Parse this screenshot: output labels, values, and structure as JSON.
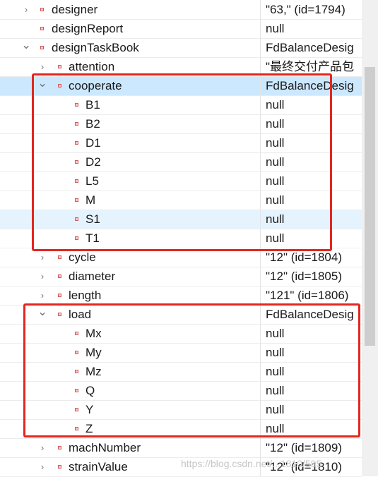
{
  "tree": {
    "rows": [
      {
        "id": "designer",
        "name": "designer",
        "value": "\"63,\" (id=1794)",
        "depth": 0,
        "arrow": "collapsed",
        "state": ""
      },
      {
        "id": "designReport",
        "name": "designReport",
        "value": "null",
        "depth": 0,
        "arrow": "none",
        "state": ""
      },
      {
        "id": "designTaskBook",
        "name": "designTaskBook",
        "value": "FdBalanceDesig",
        "depth": 0,
        "arrow": "expanded",
        "state": ""
      },
      {
        "id": "attention",
        "name": "attention",
        "value": "\"最终交付产品包",
        "depth": 1,
        "arrow": "collapsed",
        "state": ""
      },
      {
        "id": "cooperate",
        "name": "cooperate",
        "value": "FdBalanceDesig",
        "depth": 1,
        "arrow": "expanded",
        "state": "selected"
      },
      {
        "id": "B1",
        "name": "B1",
        "value": "null",
        "depth": 2,
        "arrow": "none",
        "state": ""
      },
      {
        "id": "B2",
        "name": "B2",
        "value": "null",
        "depth": 2,
        "arrow": "none",
        "state": ""
      },
      {
        "id": "D1",
        "name": "D1",
        "value": "null",
        "depth": 2,
        "arrow": "none",
        "state": ""
      },
      {
        "id": "D2",
        "name": "D2",
        "value": "null",
        "depth": 2,
        "arrow": "none",
        "state": ""
      },
      {
        "id": "L5",
        "name": "L5",
        "value": "null",
        "depth": 2,
        "arrow": "none",
        "state": ""
      },
      {
        "id": "M",
        "name": "M",
        "value": "null",
        "depth": 2,
        "arrow": "none",
        "state": ""
      },
      {
        "id": "S1",
        "name": "S1",
        "value": "null",
        "depth": 2,
        "arrow": "none",
        "state": "hover"
      },
      {
        "id": "T1",
        "name": "T1",
        "value": "null",
        "depth": 2,
        "arrow": "none",
        "state": ""
      },
      {
        "id": "cycle",
        "name": "cycle",
        "value": "\"12\" (id=1804)",
        "depth": 1,
        "arrow": "collapsed",
        "state": ""
      },
      {
        "id": "diameter",
        "name": "diameter",
        "value": "\"12\" (id=1805)",
        "depth": 1,
        "arrow": "collapsed",
        "state": ""
      },
      {
        "id": "length",
        "name": "length",
        "value": "\"121\" (id=1806)",
        "depth": 1,
        "arrow": "collapsed",
        "state": ""
      },
      {
        "id": "load",
        "name": "load",
        "value": "FdBalanceDesig",
        "depth": 1,
        "arrow": "expanded",
        "state": ""
      },
      {
        "id": "Mx",
        "name": "Mx",
        "value": "null",
        "depth": 2,
        "arrow": "none",
        "state": ""
      },
      {
        "id": "My",
        "name": "My",
        "value": "null",
        "depth": 2,
        "arrow": "none",
        "state": ""
      },
      {
        "id": "Mz",
        "name": "Mz",
        "value": "null",
        "depth": 2,
        "arrow": "none",
        "state": ""
      },
      {
        "id": "Q",
        "name": "Q",
        "value": "null",
        "depth": 2,
        "arrow": "none",
        "state": ""
      },
      {
        "id": "Y",
        "name": "Y",
        "value": "null",
        "depth": 2,
        "arrow": "none",
        "state": ""
      },
      {
        "id": "Z",
        "name": "Z",
        "value": "null",
        "depth": 2,
        "arrow": "none",
        "state": ""
      },
      {
        "id": "machNumber",
        "name": "machNumber",
        "value": "\"12\" (id=1809)",
        "depth": 1,
        "arrow": "collapsed",
        "state": ""
      },
      {
        "id": "strainValue",
        "name": "strainValue",
        "value": "\"12\" (id=1810)",
        "depth": 1,
        "arrow": "collapsed",
        "state": ""
      }
    ]
  },
  "icons": {
    "collapsed": "chevron-right-icon",
    "expanded": "chevron-down-icon",
    "field": "field-icon"
  },
  "colors": {
    "highlight_box": "#e3261f",
    "selected_row": "#cce8ff",
    "hover_row": "#e5f3ff",
    "field_icon": "#d45a5a"
  },
  "watermark": "https://blog.csdn.net/...1810/585"
}
